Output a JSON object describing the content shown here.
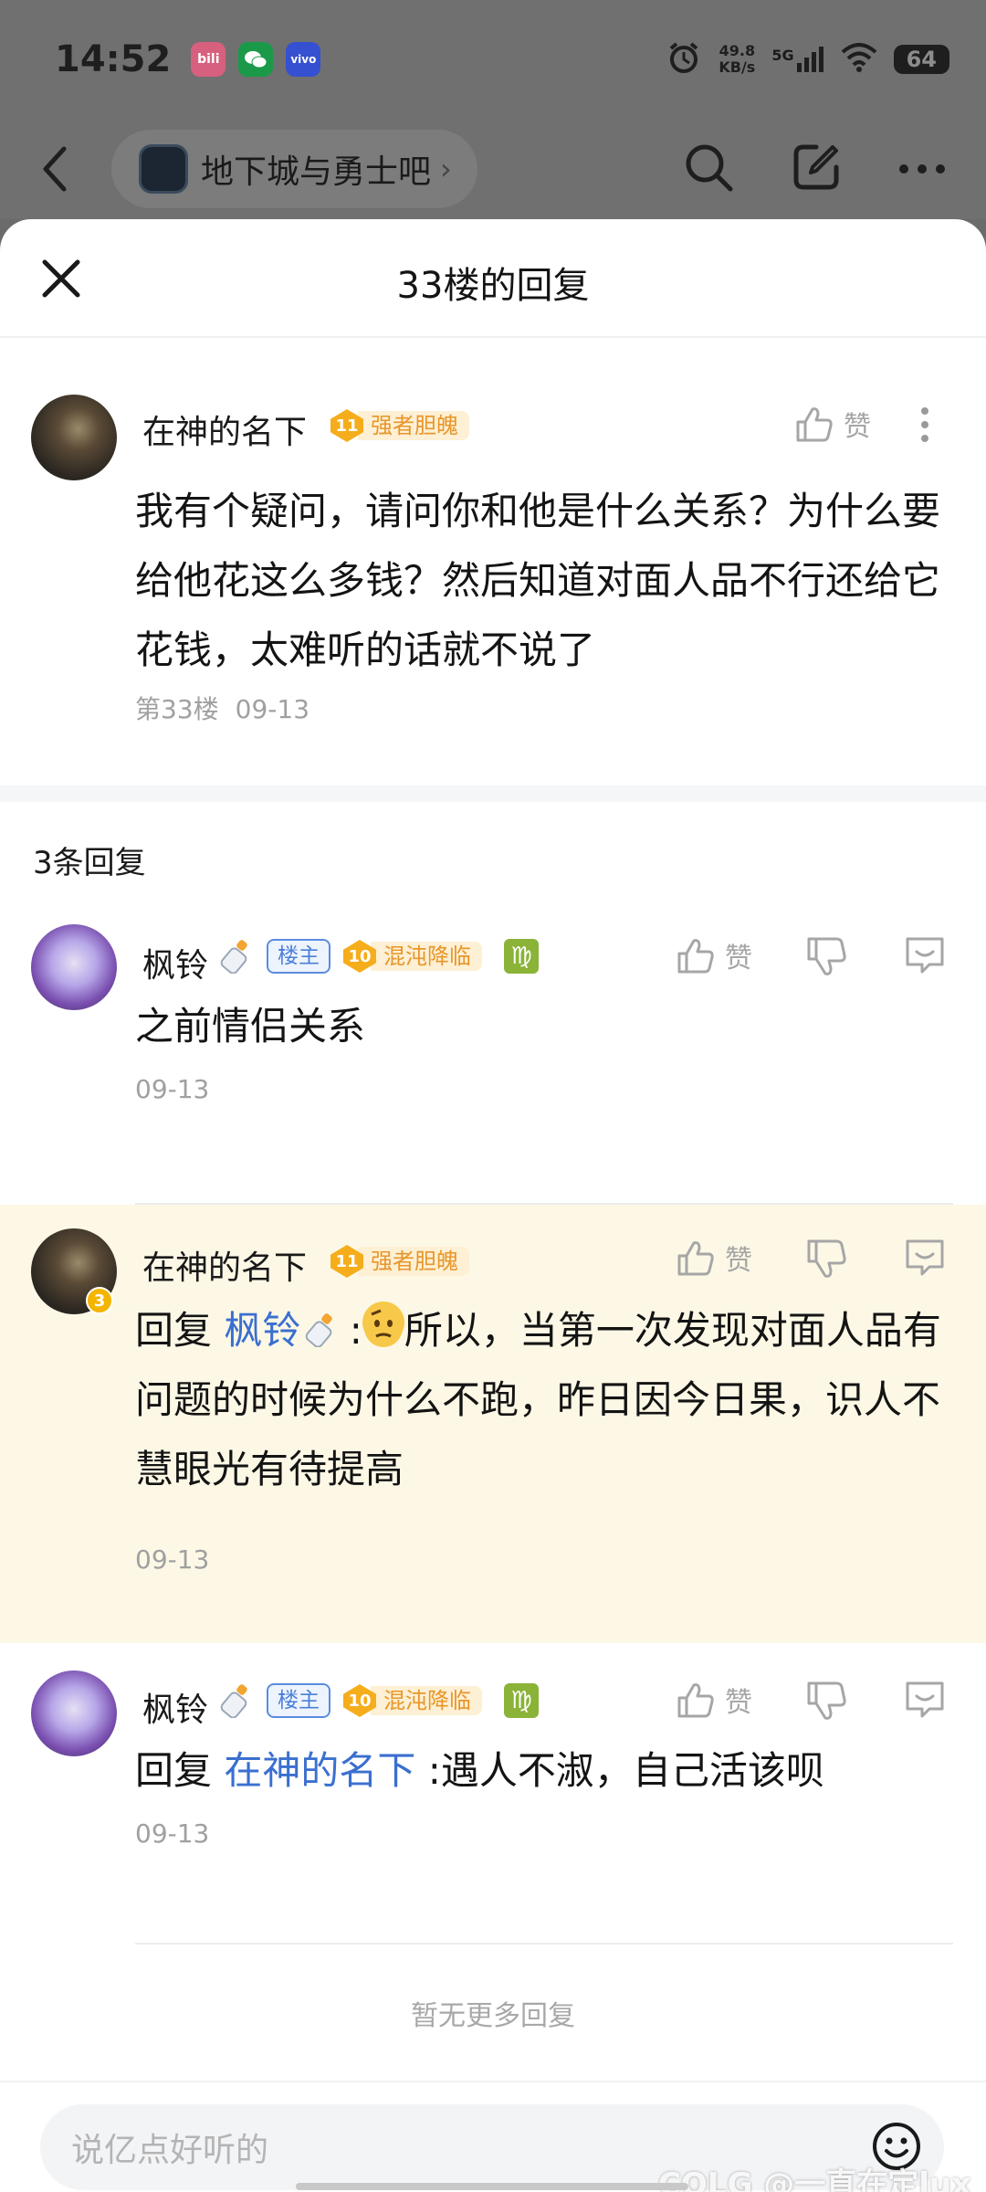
{
  "status_bar": {
    "time": "14:52",
    "apps": [
      {
        "name": "bilibili-icon",
        "label": "bili",
        "color": "#fb7299"
      },
      {
        "name": "wechat-icon",
        "label": "",
        "color": "#23c35a"
      },
      {
        "name": "vivo-icon",
        "label": "vivo",
        "color": "#415fff"
      }
    ],
    "net_speed_value": "49.8",
    "net_speed_unit": "KB/s",
    "signal": "5G",
    "battery": "64"
  },
  "nav": {
    "forum_name": "地下城与勇士吧",
    "chip_arrow": "›"
  },
  "sheet": {
    "title": "33楼的回复"
  },
  "main_post": {
    "username": "在神的名下",
    "level": "11",
    "level_title": "强者胆魄",
    "like_label": "赞",
    "content": "我有个疑问，请问你和他是什么关系？为什么要给他花这么多钱？然后知道对面人品不行还给它花钱，太难听的话就不说了",
    "floor": "第33楼",
    "date": "09-13"
  },
  "replies_count": "3条回复",
  "replies": [
    {
      "username": "枫铃",
      "owner_tag": "楼主",
      "level": "10",
      "level_title": "混沌降临",
      "zodiac": "♍",
      "like_label": "赞",
      "content": "之前情侣关系",
      "date": "09-13"
    },
    {
      "username": "在神的名下",
      "avatar_badge": "3",
      "level": "11",
      "level_title": "强者胆魄",
      "like_label": "赞",
      "reply_prefix": "回复 ",
      "reply_to": "枫铃",
      "reply_sep": " :",
      "content": "所以，当第一次发现对面人品有问题的时候为什么不跑，昨日因今日果，识人不慧眼光有待提高",
      "date": "09-13"
    },
    {
      "username": "枫铃",
      "owner_tag": "楼主",
      "level": "10",
      "level_title": "混沌降临",
      "zodiac": "♍",
      "like_label": "赞",
      "reply_prefix": "回复 ",
      "reply_to": "在神的名下",
      "reply_sep": " :",
      "content": "遇人不淑，自己活该呗",
      "date": "09-13"
    }
  ],
  "no_more": "暂无更多回复",
  "input": {
    "placeholder": "说亿点好听的"
  },
  "watermark": "COLG @一直在定lux"
}
